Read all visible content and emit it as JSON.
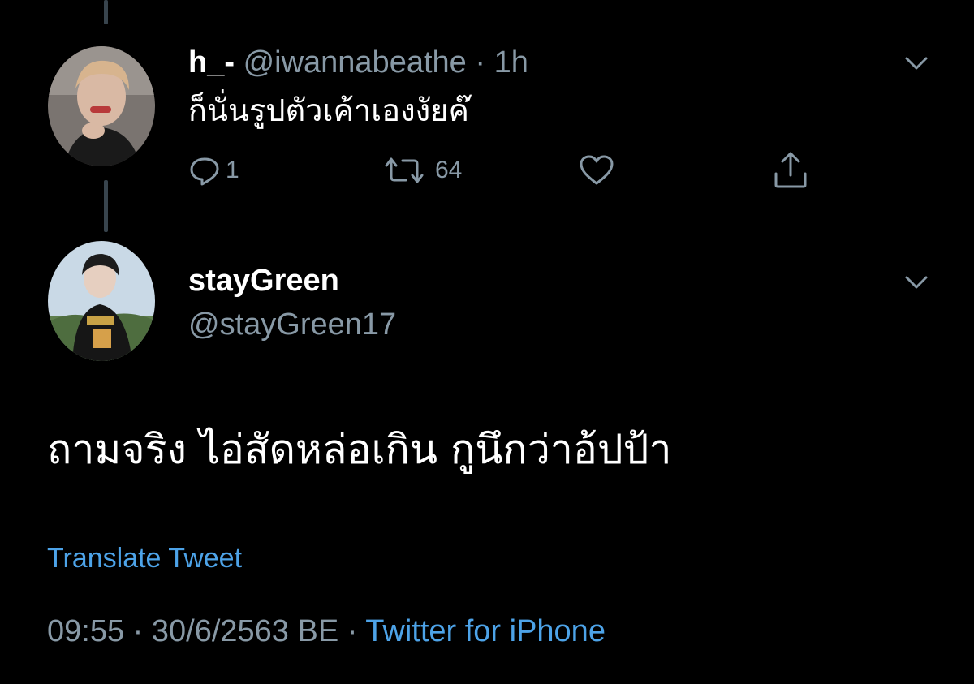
{
  "reply_tweet": {
    "display_name": "h_-",
    "handle": "@iwannabeathe",
    "separator": "·",
    "time": "1h",
    "text": "ก็นั่นรูปตัวเค้าเองงัยค๊",
    "actions": {
      "reply_count": "1",
      "retweet_count": "64",
      "like_count": "",
      "icons": [
        "reply-icon",
        "retweet-icon",
        "like-icon",
        "share-icon"
      ]
    }
  },
  "main_tweet": {
    "display_name": "stayGreen",
    "handle": "@stayGreen17",
    "text": "ถามจริง ไอ่สัดหล่อเกิน กูนึกว่าอ้ปป้า",
    "translate_label": "Translate Tweet",
    "timestamp": "09:55 · 30/6/2563 BE",
    "separator": "·",
    "source": "Twitter for iPhone"
  },
  "colors": {
    "background": "#000000",
    "primary_text": "#ffffff",
    "secondary_text": "#8899a6",
    "link": "#4da3e8",
    "thread_line": "#38444d"
  }
}
